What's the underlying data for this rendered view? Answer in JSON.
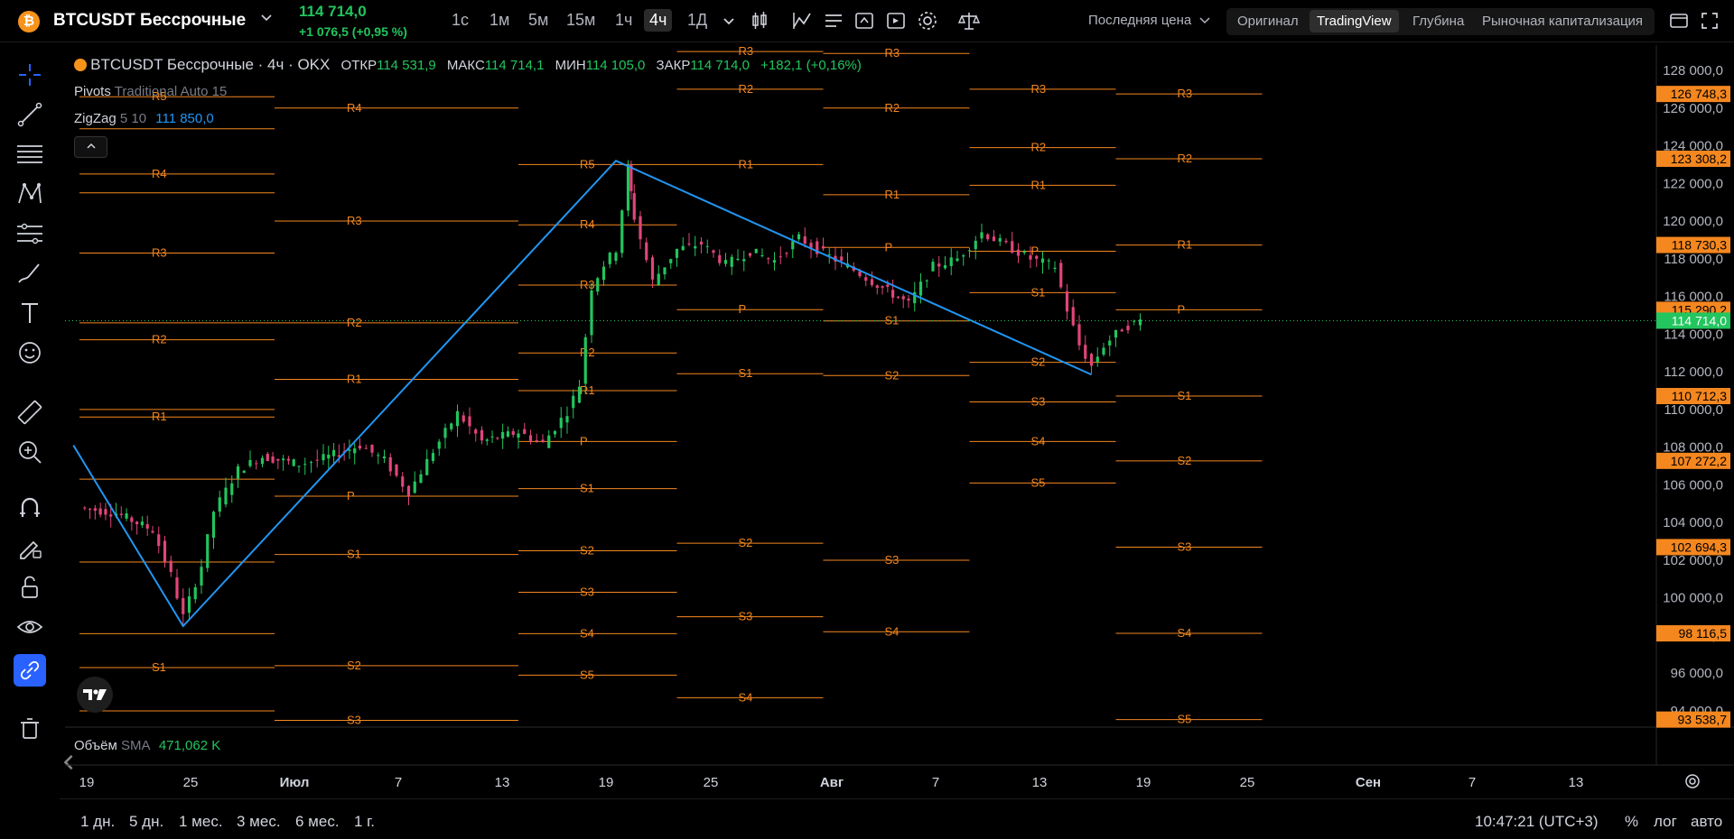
{
  "header": {
    "coin_glyph": "₿",
    "symbol": "BTCUSDT Бессрочные",
    "price": "114 714,0",
    "change": "+1 076,5 (+0,95 %)",
    "timeframes": [
      "1с",
      "1м",
      "5м",
      "15м",
      "1ч",
      "4ч",
      "1Д"
    ],
    "active_timeframe": "4ч",
    "price_type": "Последняя цена",
    "modes": [
      "Оригинал",
      "TradingView",
      "Глубина",
      "Рыночная капитализация"
    ],
    "active_mode": "TradingView"
  },
  "legend": {
    "title": "BTCUSDT Бессрочные · 4ч · OKX",
    "open_label": "ОТКР",
    "open": "114 531,9",
    "high_label": "МАКС",
    "high": "114 714,1",
    "low_label": "МИН",
    "low": "114 105,0",
    "close_label": "ЗАКР",
    "close": "114 714,0",
    "change": "+182,1 (+0,16%)",
    "pivots_name": "Pivots",
    "pivots_params": "Traditional Auto 15",
    "zigzag_name": "ZigZag",
    "zigzag_params": "5 10",
    "zigzag_value": "111 850,0",
    "volume_name": "Объём",
    "volume_ma": "SMA",
    "volume_value": "471,062 K"
  },
  "bottom": {
    "periods": [
      "1 дн.",
      "5 дн.",
      "1 мес.",
      "3 мес.",
      "6 мес.",
      "1 г."
    ],
    "time": "10:47:21 (UTC+3)",
    "percent": "%",
    "log": "лог",
    "auto": "авто"
  },
  "colors": {
    "up": "#22c55e",
    "down": "#e0457b",
    "pivot": "#f5871f",
    "zigzag": "#2196f3",
    "bg": "#000000"
  },
  "chart_data": {
    "type": "candlestick",
    "y_axis": {
      "min": 93000,
      "max": 129000,
      "ticks": [
        94000,
        96000,
        98000,
        100000,
        102000,
        104000,
        106000,
        108000,
        110000,
        112000,
        114000,
        116000,
        118000,
        120000,
        122000,
        124000,
        126000,
        128000
      ]
    },
    "x_axis": {
      "labels": [
        "19",
        "25",
        "Июл",
        "7",
        "13",
        "19",
        "25",
        "Авг",
        "7",
        "13",
        "19",
        "25",
        "Сен",
        "7",
        "13"
      ]
    },
    "price_labels": [
      {
        "value": 126748.3,
        "text": "126 748,3"
      },
      {
        "value": 123308.2,
        "text": "123 308,2"
      },
      {
        "value": 118730.3,
        "text": "118 730,3"
      },
      {
        "value": 115290.2,
        "text": "115 290,2"
      },
      {
        "value": 114714.0,
        "text": "114 714,0",
        "current": true
      },
      {
        "value": 110712.3,
        "text": "110 712,3"
      },
      {
        "value": 107272.2,
        "text": "107 272,2"
      },
      {
        "value": 102694.3,
        "text": "102 694,3"
      },
      {
        "value": 98116.5,
        "text": "98 116,5"
      },
      {
        "value": 93538.7,
        "text": "93 538,7"
      }
    ],
    "pivot_periods": [
      {
        "x1": 0,
        "x2": 1.6,
        "levels": [
          {
            "n": "R5",
            "v": 126600
          },
          {
            "n": "",
            "v": 124900
          },
          {
            "n": "R4",
            "v": 122500
          },
          {
            "n": "",
            "v": 121500
          },
          {
            "n": "R3",
            "v": 118300
          },
          {
            "n": "",
            "v": 114600
          },
          {
            "n": "R2",
            "v": 113700
          },
          {
            "n": "",
            "v": 110000
          },
          {
            "n": "R1",
            "v": 109600
          },
          {
            "n": "",
            "v": 106300
          },
          {
            "n": "",
            "v": 101900
          },
          {
            "n": "",
            "v": 98100
          },
          {
            "n": "S1",
            "v": 96300
          },
          {
            "n": "",
            "v": 94000
          }
        ]
      },
      {
        "x1": 1.6,
        "x2": 3.6,
        "levels": [
          {
            "n": "R4",
            "v": 126000
          },
          {
            "n": "R3",
            "v": 120000
          },
          {
            "n": "R2",
            "v": 114600
          },
          {
            "n": "R1",
            "v": 111600
          },
          {
            "n": "P",
            "v": 105400
          },
          {
            "n": "S1",
            "v": 102300
          },
          {
            "n": "S2",
            "v": 96400
          },
          {
            "n": "S3",
            "v": 93500
          }
        ]
      },
      {
        "x1": 3.6,
        "x2": 4.9,
        "levels": [
          {
            "n": "R5",
            "v": 123000
          },
          {
            "n": "R4",
            "v": 119800
          },
          {
            "n": "R3",
            "v": 116600
          },
          {
            "n": "R2",
            "v": 113000
          },
          {
            "n": "R1",
            "v": 111000
          },
          {
            "n": "P",
            "v": 108300
          },
          {
            "n": "S1",
            "v": 105800
          },
          {
            "n": "S2",
            "v": 102500
          },
          {
            "n": "S3",
            "v": 100300
          },
          {
            "n": "S4",
            "v": 98100
          },
          {
            "n": "S5",
            "v": 95900
          }
        ]
      },
      {
        "x1": 4.9,
        "x2": 6.1,
        "levels": [
          {
            "n": "R3",
            "v": 129000
          },
          {
            "n": "R2",
            "v": 127000
          },
          {
            "n": "R1",
            "v": 123000
          },
          {
            "n": "P",
            "v": 115300
          },
          {
            "n": "S1",
            "v": 111900
          },
          {
            "n": "S2",
            "v": 102900
          },
          {
            "n": "S3",
            "v": 99000
          },
          {
            "n": "S4",
            "v": 94700
          }
        ]
      },
      {
        "x1": 6.1,
        "x2": 7.3,
        "levels": [
          {
            "n": "R3",
            "v": 128900
          },
          {
            "n": "R2",
            "v": 126000
          },
          {
            "n": "R1",
            "v": 121400
          },
          {
            "n": "P",
            "v": 118600
          },
          {
            "n": "S1",
            "v": 114700
          },
          {
            "n": "S2",
            "v": 111800
          },
          {
            "n": "S3",
            "v": 102000
          },
          {
            "n": "S4",
            "v": 98200
          }
        ]
      },
      {
        "x1": 7.3,
        "x2": 8.5,
        "levels": [
          {
            "n": "R3",
            "v": 127000
          },
          {
            "n": "R2",
            "v": 123900
          },
          {
            "n": "R1",
            "v": 121900
          },
          {
            "n": "P",
            "v": 118400
          },
          {
            "n": "S1",
            "v": 116200
          },
          {
            "n": "S2",
            "v": 112500
          },
          {
            "n": "S3",
            "v": 110400
          },
          {
            "n": "S4",
            "v": 108300
          },
          {
            "n": "S5",
            "v": 106100
          }
        ]
      },
      {
        "x1": 8.5,
        "x2": 9.7,
        "levels": [
          {
            "n": "R3",
            "v": 126748.3
          },
          {
            "n": "R2",
            "v": 123308.2
          },
          {
            "n": "R1",
            "v": 118730.3
          },
          {
            "n": "P",
            "v": 115290.2
          },
          {
            "n": "S1",
            "v": 110712.3
          },
          {
            "n": "S2",
            "v": 107272.2
          },
          {
            "n": "S3",
            "v": 102694.3
          },
          {
            "n": "S4",
            "v": 98116.5
          },
          {
            "n": "S5",
            "v": 93538.7
          }
        ]
      }
    ],
    "zigzag": [
      {
        "t": -0.05,
        "v": 108100
      },
      {
        "t": 0.85,
        "v": 98500
      },
      {
        "t": 4.4,
        "v": 123200
      },
      {
        "t": 8.3,
        "v": 111850
      }
    ],
    "price_path": [
      {
        "t": 0,
        "v": 104800
      },
      {
        "t": 0.3,
        "v": 104500
      },
      {
        "t": 0.6,
        "v": 103600
      },
      {
        "t": 0.75,
        "v": 101200
      },
      {
        "t": 0.85,
        "v": 99000
      },
      {
        "t": 1.0,
        "v": 101700
      },
      {
        "t": 1.1,
        "v": 104600
      },
      {
        "t": 1.3,
        "v": 106800
      },
      {
        "t": 1.5,
        "v": 107500
      },
      {
        "t": 1.8,
        "v": 107100
      },
      {
        "t": 2.0,
        "v": 107400
      },
      {
        "t": 2.3,
        "v": 108100
      },
      {
        "t": 2.5,
        "v": 107300
      },
      {
        "t": 2.7,
        "v": 105600
      },
      {
        "t": 2.9,
        "v": 107800
      },
      {
        "t": 3.1,
        "v": 109800
      },
      {
        "t": 3.3,
        "v": 108300
      },
      {
        "t": 3.6,
        "v": 108800
      },
      {
        "t": 3.8,
        "v": 108200
      },
      {
        "t": 4.0,
        "v": 109900
      },
      {
        "t": 4.1,
        "v": 111300
      },
      {
        "t": 4.2,
        "v": 116500
      },
      {
        "t": 4.3,
        "v": 117700
      },
      {
        "t": 4.4,
        "v": 118500
      },
      {
        "t": 4.5,
        "v": 122800
      },
      {
        "t": 4.55,
        "v": 120200
      },
      {
        "t": 4.7,
        "v": 116800
      },
      {
        "t": 4.9,
        "v": 118500
      },
      {
        "t": 5.1,
        "v": 118800
      },
      {
        "t": 5.3,
        "v": 117700
      },
      {
        "t": 5.5,
        "v": 118400
      },
      {
        "t": 5.7,
        "v": 117900
      },
      {
        "t": 5.9,
        "v": 119100
      },
      {
        "t": 6.1,
        "v": 118300
      },
      {
        "t": 6.3,
        "v": 117600
      },
      {
        "t": 6.5,
        "v": 116800
      },
      {
        "t": 6.8,
        "v": 115600
      },
      {
        "t": 7.0,
        "v": 117600
      },
      {
        "t": 7.2,
        "v": 118000
      },
      {
        "t": 7.4,
        "v": 119400
      },
      {
        "t": 7.6,
        "v": 118700
      },
      {
        "t": 7.8,
        "v": 118000
      },
      {
        "t": 8.0,
        "v": 117600
      },
      {
        "t": 8.1,
        "v": 115300
      },
      {
        "t": 8.2,
        "v": 113400
      },
      {
        "t": 8.3,
        "v": 112300
      },
      {
        "t": 8.4,
        "v": 113400
      },
      {
        "t": 8.55,
        "v": 114300
      },
      {
        "t": 8.7,
        "v": 114714
      }
    ]
  }
}
